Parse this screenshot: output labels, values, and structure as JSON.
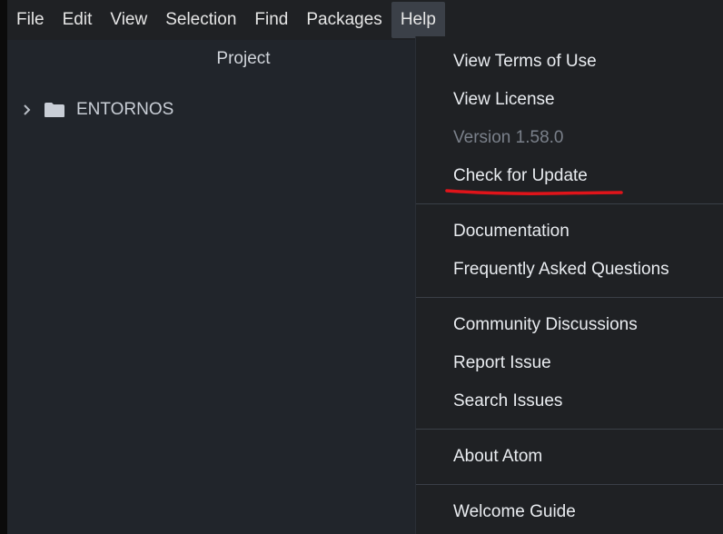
{
  "menubar": {
    "items": [
      {
        "label": "File"
      },
      {
        "label": "Edit"
      },
      {
        "label": "View"
      },
      {
        "label": "Selection"
      },
      {
        "label": "Find"
      },
      {
        "label": "Packages"
      },
      {
        "label": "Help"
      }
    ]
  },
  "tree": {
    "title": "Project",
    "root_label": "ENTORNOS"
  },
  "help_menu": {
    "group1": [
      "View Terms of Use",
      "View License",
      "Version 1.58.0",
      "Check for Update"
    ],
    "group2": [
      "Documentation",
      "Frequently Asked Questions"
    ],
    "group3": [
      "Community Discussions",
      "Report Issue",
      "Search Issues"
    ],
    "group4": [
      "About Atom"
    ],
    "group5": [
      "Welcome Guide"
    ]
  },
  "colors": {
    "annotation_underline": "#e0141a",
    "menu_background": "#1f2124",
    "pane_background": "#21252b"
  },
  "icons": {
    "tree_chevron": "chevron-right-icon",
    "tree_folder": "folder-icon"
  }
}
